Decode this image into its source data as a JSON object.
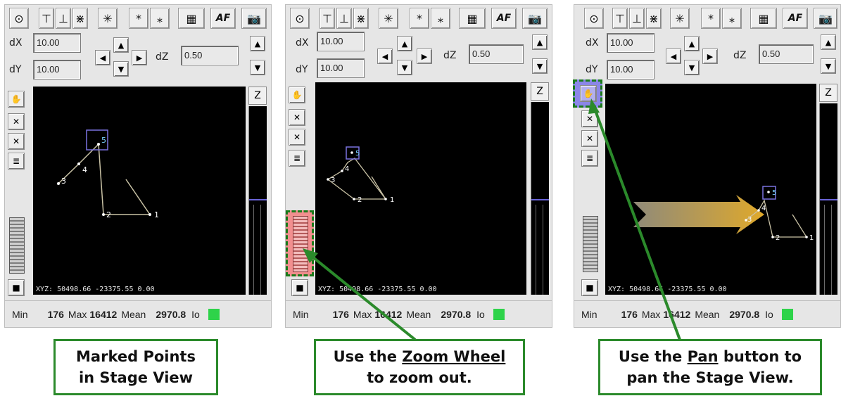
{
  "toolbar": {
    "icons": [
      "target-icon",
      "align-top-icon",
      "align-bottom-icon",
      "align-center-icon",
      "star-icon",
      "star-top-icon",
      "star-bottom-icon",
      "grid-icon"
    ],
    "af_label": "AF",
    "camera_icon": "camera-icon"
  },
  "controls": {
    "dx_label": "dX",
    "dx_value": "10.00",
    "dy_label": "dY",
    "dy_value": "10.00",
    "dz_label": "dZ",
    "dz_value": "0.50"
  },
  "view": {
    "z_label": "Z",
    "xyz_readout": "XYZ: 50498.66 -23375.55 0.00",
    "points": [
      "1",
      "2",
      "3",
      "4",
      "5"
    ]
  },
  "status": {
    "min_label": "Min",
    "min_value": "176",
    "max_label": "Max",
    "max_value": "16412",
    "mean_label": "Mean",
    "mean_value": "2970.8",
    "io_label": "Io"
  },
  "captions": {
    "panel1_line1": "Marked Points",
    "panel1_line2": "in Stage View",
    "panel2_pre": "Use the ",
    "panel2_link": "Zoom Wheel",
    "panel2_line2": "to zoom out.",
    "panel3_pre": "Use the ",
    "panel3_link": "Pan",
    "panel3_post": " button to",
    "panel3_line2": "pan the Stage View."
  },
  "colors": {
    "accent_green": "#2b8a2b",
    "highlight_red": "#f08a8a",
    "highlight_blue": "#8b86e8",
    "arrow_gold": "#c9a23a"
  }
}
